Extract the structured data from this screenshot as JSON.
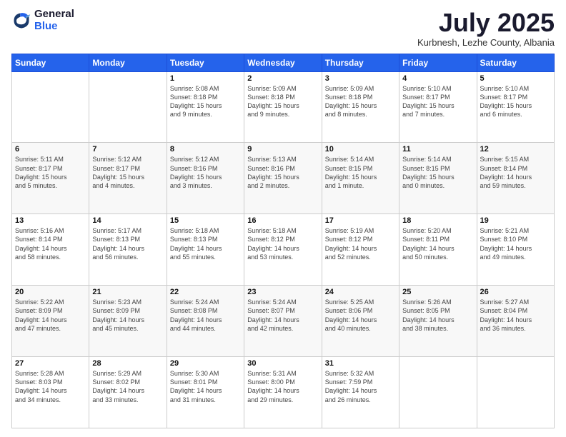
{
  "logo": {
    "general": "General",
    "blue": "Blue"
  },
  "title": "July 2025",
  "subtitle": "Kurbnesh, Lezhe County, Albania",
  "weekdays": [
    "Sunday",
    "Monday",
    "Tuesday",
    "Wednesday",
    "Thursday",
    "Friday",
    "Saturday"
  ],
  "weeks": [
    [
      {
        "day": "",
        "info": ""
      },
      {
        "day": "",
        "info": ""
      },
      {
        "day": "1",
        "info": "Sunrise: 5:08 AM\nSunset: 8:18 PM\nDaylight: 15 hours\nand 9 minutes."
      },
      {
        "day": "2",
        "info": "Sunrise: 5:09 AM\nSunset: 8:18 PM\nDaylight: 15 hours\nand 9 minutes."
      },
      {
        "day": "3",
        "info": "Sunrise: 5:09 AM\nSunset: 8:18 PM\nDaylight: 15 hours\nand 8 minutes."
      },
      {
        "day": "4",
        "info": "Sunrise: 5:10 AM\nSunset: 8:17 PM\nDaylight: 15 hours\nand 7 minutes."
      },
      {
        "day": "5",
        "info": "Sunrise: 5:10 AM\nSunset: 8:17 PM\nDaylight: 15 hours\nand 6 minutes."
      }
    ],
    [
      {
        "day": "6",
        "info": "Sunrise: 5:11 AM\nSunset: 8:17 PM\nDaylight: 15 hours\nand 5 minutes."
      },
      {
        "day": "7",
        "info": "Sunrise: 5:12 AM\nSunset: 8:17 PM\nDaylight: 15 hours\nand 4 minutes."
      },
      {
        "day": "8",
        "info": "Sunrise: 5:12 AM\nSunset: 8:16 PM\nDaylight: 15 hours\nand 3 minutes."
      },
      {
        "day": "9",
        "info": "Sunrise: 5:13 AM\nSunset: 8:16 PM\nDaylight: 15 hours\nand 2 minutes."
      },
      {
        "day": "10",
        "info": "Sunrise: 5:14 AM\nSunset: 8:15 PM\nDaylight: 15 hours\nand 1 minute."
      },
      {
        "day": "11",
        "info": "Sunrise: 5:14 AM\nSunset: 8:15 PM\nDaylight: 15 hours\nand 0 minutes."
      },
      {
        "day": "12",
        "info": "Sunrise: 5:15 AM\nSunset: 8:14 PM\nDaylight: 14 hours\nand 59 minutes."
      }
    ],
    [
      {
        "day": "13",
        "info": "Sunrise: 5:16 AM\nSunset: 8:14 PM\nDaylight: 14 hours\nand 58 minutes."
      },
      {
        "day": "14",
        "info": "Sunrise: 5:17 AM\nSunset: 8:13 PM\nDaylight: 14 hours\nand 56 minutes."
      },
      {
        "day": "15",
        "info": "Sunrise: 5:18 AM\nSunset: 8:13 PM\nDaylight: 14 hours\nand 55 minutes."
      },
      {
        "day": "16",
        "info": "Sunrise: 5:18 AM\nSunset: 8:12 PM\nDaylight: 14 hours\nand 53 minutes."
      },
      {
        "day": "17",
        "info": "Sunrise: 5:19 AM\nSunset: 8:12 PM\nDaylight: 14 hours\nand 52 minutes."
      },
      {
        "day": "18",
        "info": "Sunrise: 5:20 AM\nSunset: 8:11 PM\nDaylight: 14 hours\nand 50 minutes."
      },
      {
        "day": "19",
        "info": "Sunrise: 5:21 AM\nSunset: 8:10 PM\nDaylight: 14 hours\nand 49 minutes."
      }
    ],
    [
      {
        "day": "20",
        "info": "Sunrise: 5:22 AM\nSunset: 8:09 PM\nDaylight: 14 hours\nand 47 minutes."
      },
      {
        "day": "21",
        "info": "Sunrise: 5:23 AM\nSunset: 8:09 PM\nDaylight: 14 hours\nand 45 minutes."
      },
      {
        "day": "22",
        "info": "Sunrise: 5:24 AM\nSunset: 8:08 PM\nDaylight: 14 hours\nand 44 minutes."
      },
      {
        "day": "23",
        "info": "Sunrise: 5:24 AM\nSunset: 8:07 PM\nDaylight: 14 hours\nand 42 minutes."
      },
      {
        "day": "24",
        "info": "Sunrise: 5:25 AM\nSunset: 8:06 PM\nDaylight: 14 hours\nand 40 minutes."
      },
      {
        "day": "25",
        "info": "Sunrise: 5:26 AM\nSunset: 8:05 PM\nDaylight: 14 hours\nand 38 minutes."
      },
      {
        "day": "26",
        "info": "Sunrise: 5:27 AM\nSunset: 8:04 PM\nDaylight: 14 hours\nand 36 minutes."
      }
    ],
    [
      {
        "day": "27",
        "info": "Sunrise: 5:28 AM\nSunset: 8:03 PM\nDaylight: 14 hours\nand 34 minutes."
      },
      {
        "day": "28",
        "info": "Sunrise: 5:29 AM\nSunset: 8:02 PM\nDaylight: 14 hours\nand 33 minutes."
      },
      {
        "day": "29",
        "info": "Sunrise: 5:30 AM\nSunset: 8:01 PM\nDaylight: 14 hours\nand 31 minutes."
      },
      {
        "day": "30",
        "info": "Sunrise: 5:31 AM\nSunset: 8:00 PM\nDaylight: 14 hours\nand 29 minutes."
      },
      {
        "day": "31",
        "info": "Sunrise: 5:32 AM\nSunset: 7:59 PM\nDaylight: 14 hours\nand 26 minutes."
      },
      {
        "day": "",
        "info": ""
      },
      {
        "day": "",
        "info": ""
      }
    ]
  ]
}
